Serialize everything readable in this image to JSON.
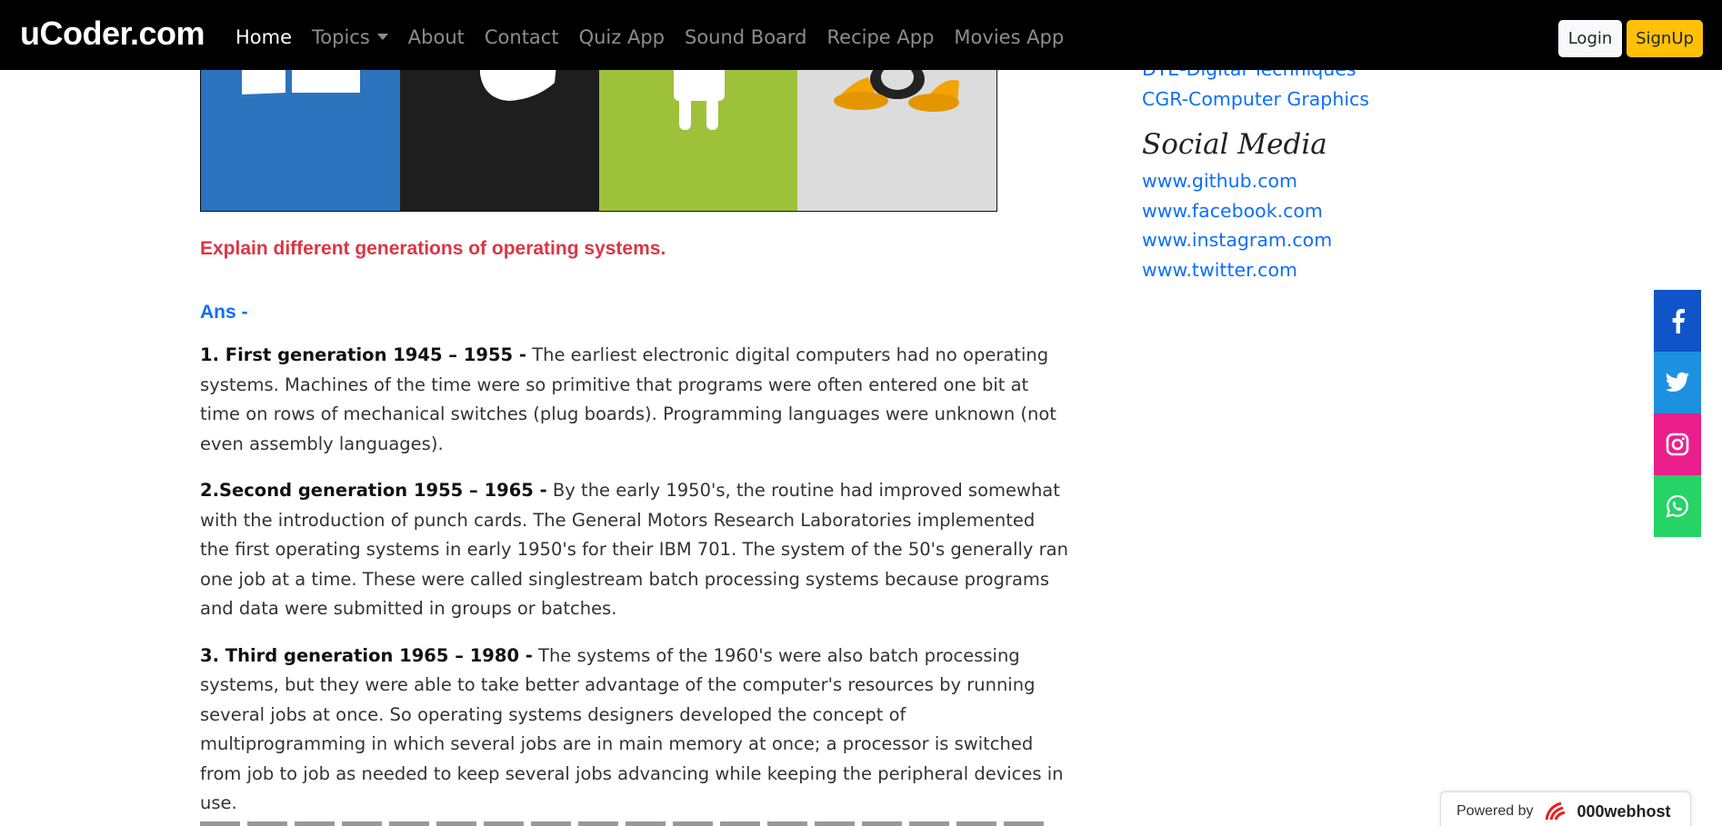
{
  "navbar": {
    "brand": "uCoder.com",
    "links": [
      {
        "label": "Home",
        "active": true
      },
      {
        "label": "Topics",
        "dropdown": true
      },
      {
        "label": "About"
      },
      {
        "label": "Contact"
      },
      {
        "label": "Quiz App"
      },
      {
        "label": "Sound Board"
      },
      {
        "label": "Recipe App"
      },
      {
        "label": "Movies App"
      }
    ],
    "login_label": "Login",
    "signup_label": "SignUp"
  },
  "article": {
    "question": "Explain different generations of operating systems.",
    "answer_label": "Ans -",
    "paragraphs": [
      {
        "heading": "1. First generation 1945 – 1955 -",
        "text": " The earliest electronic digital computers had no operating systems. Machines of the time were so primitive that programs were often entered one bit at time on rows of mechanical switches (plug boards). Programming languages were unknown (not even assembly languages)."
      },
      {
        "heading": "2.Second generation 1955 – 1965 -",
        "text": " By the early 1950's, the routine had improved somewhat with the introduction of punch cards. The General Motors Research Laboratories implemented the first operating systems in early 1950's for their IBM 701. The system of the 50's generally ran one job at a time. These were called singlestream batch processing systems because programs and data were submitted in groups or batches."
      },
      {
        "heading": "3. Third generation 1965 – 1980 -",
        "text": " The systems of the 1960's were also batch processing systems, but they were able to take better advantage of the computer's resources by running several jobs at once. So operating systems designers developed the concept of multiprogramming in which several jobs are in main memory at once; a processor is switched from job to job as needed to keep several jobs advancing while keeping the peripheral devices in use."
      }
    ]
  },
  "sidebar": {
    "top_links": [
      "DTE-Digital Techniques",
      "CGR-Computer Graphics"
    ],
    "social_heading": "Social Media",
    "social_links": [
      "www.github.com",
      "www.facebook.com",
      "www.instagram.com",
      "www.twitter.com"
    ]
  },
  "share_bar": {
    "icons": [
      "facebook-icon",
      "twitter-icon",
      "instagram-icon",
      "whatsapp-icon"
    ],
    "colors": {
      "facebook": "#0f54c9",
      "twitter": "#1e90e0",
      "instagram": "#e91e8c",
      "whatsapp": "#25d366"
    }
  },
  "footer_badge": {
    "prefix": "Powered by",
    "brand": "000webhost"
  },
  "colors": {
    "question": "#dc3545",
    "link": "#0d6efd",
    "signup": "#ffc107"
  }
}
